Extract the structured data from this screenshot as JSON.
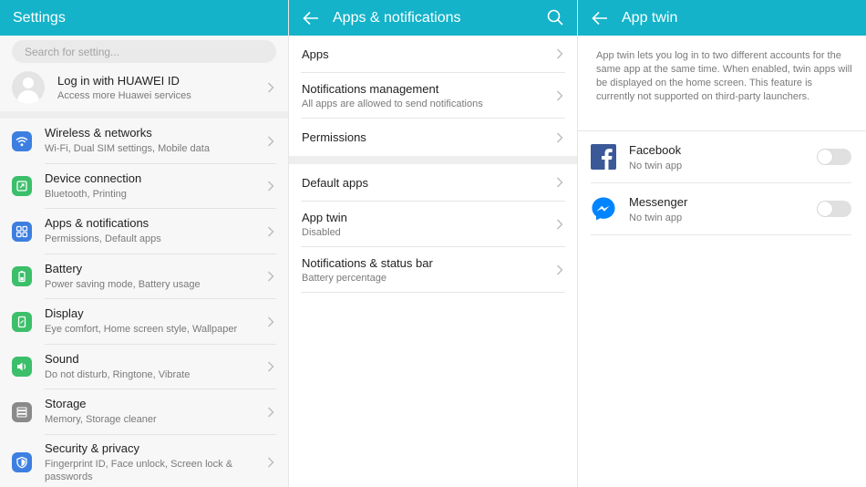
{
  "colors": {
    "accent": "#14b3c9",
    "wifi": "#3d7fe0",
    "device": "#3cbf6a",
    "apps": "#3d7fe0",
    "battery": "#3cbf6a",
    "display": "#3cbf6a",
    "sound": "#3cbf6a",
    "storage": "#8a8a8a",
    "security": "#3d7fe0"
  },
  "screen1": {
    "title": "Settings",
    "search_placeholder": "Search for setting...",
    "account": {
      "title": "Log in with HUAWEI ID",
      "subtitle": "Access more Huawei services"
    },
    "items": [
      {
        "title": "Wireless & networks",
        "subtitle": "Wi-Fi, Dual SIM settings, Mobile data",
        "icon": "wifi-icon"
      },
      {
        "title": "Device connection",
        "subtitle": "Bluetooth, Printing",
        "icon": "device-connection-icon"
      },
      {
        "title": "Apps & notifications",
        "subtitle": "Permissions, Default apps",
        "icon": "apps-grid-icon"
      },
      {
        "title": "Battery",
        "subtitle": "Power saving mode, Battery usage",
        "icon": "battery-icon"
      },
      {
        "title": "Display",
        "subtitle": "Eye comfort, Home screen style, Wallpaper",
        "icon": "display-icon"
      },
      {
        "title": "Sound",
        "subtitle": "Do not disturb, Ringtone, Vibrate",
        "icon": "sound-icon"
      },
      {
        "title": "Storage",
        "subtitle": "Memory, Storage cleaner",
        "icon": "storage-icon"
      },
      {
        "title": "Security & privacy",
        "subtitle": "Fingerprint ID, Face unlock, Screen lock & passwords",
        "icon": "shield-icon"
      }
    ]
  },
  "screen2": {
    "title": "Apps & notifications",
    "group1": [
      {
        "title": "Apps",
        "subtitle": ""
      },
      {
        "title": "Notifications management",
        "subtitle": "All apps are allowed to send notifications"
      },
      {
        "title": "Permissions",
        "subtitle": ""
      }
    ],
    "group2": [
      {
        "title": "Default apps",
        "subtitle": ""
      },
      {
        "title": "App twin",
        "subtitle": "Disabled"
      },
      {
        "title": "Notifications & status bar",
        "subtitle": "Battery percentage"
      }
    ]
  },
  "screen3": {
    "title": "App twin",
    "description": "App twin lets you log in to two different accounts for the same app at the same time. When enabled, twin apps will be displayed on the home screen. This feature is currently not supported on third-party launchers.",
    "apps": [
      {
        "name": "Facebook",
        "status": "No twin app",
        "enabled": false,
        "icon": "facebook-icon"
      },
      {
        "name": "Messenger",
        "status": "No twin app",
        "enabled": false,
        "icon": "messenger-icon"
      }
    ]
  }
}
